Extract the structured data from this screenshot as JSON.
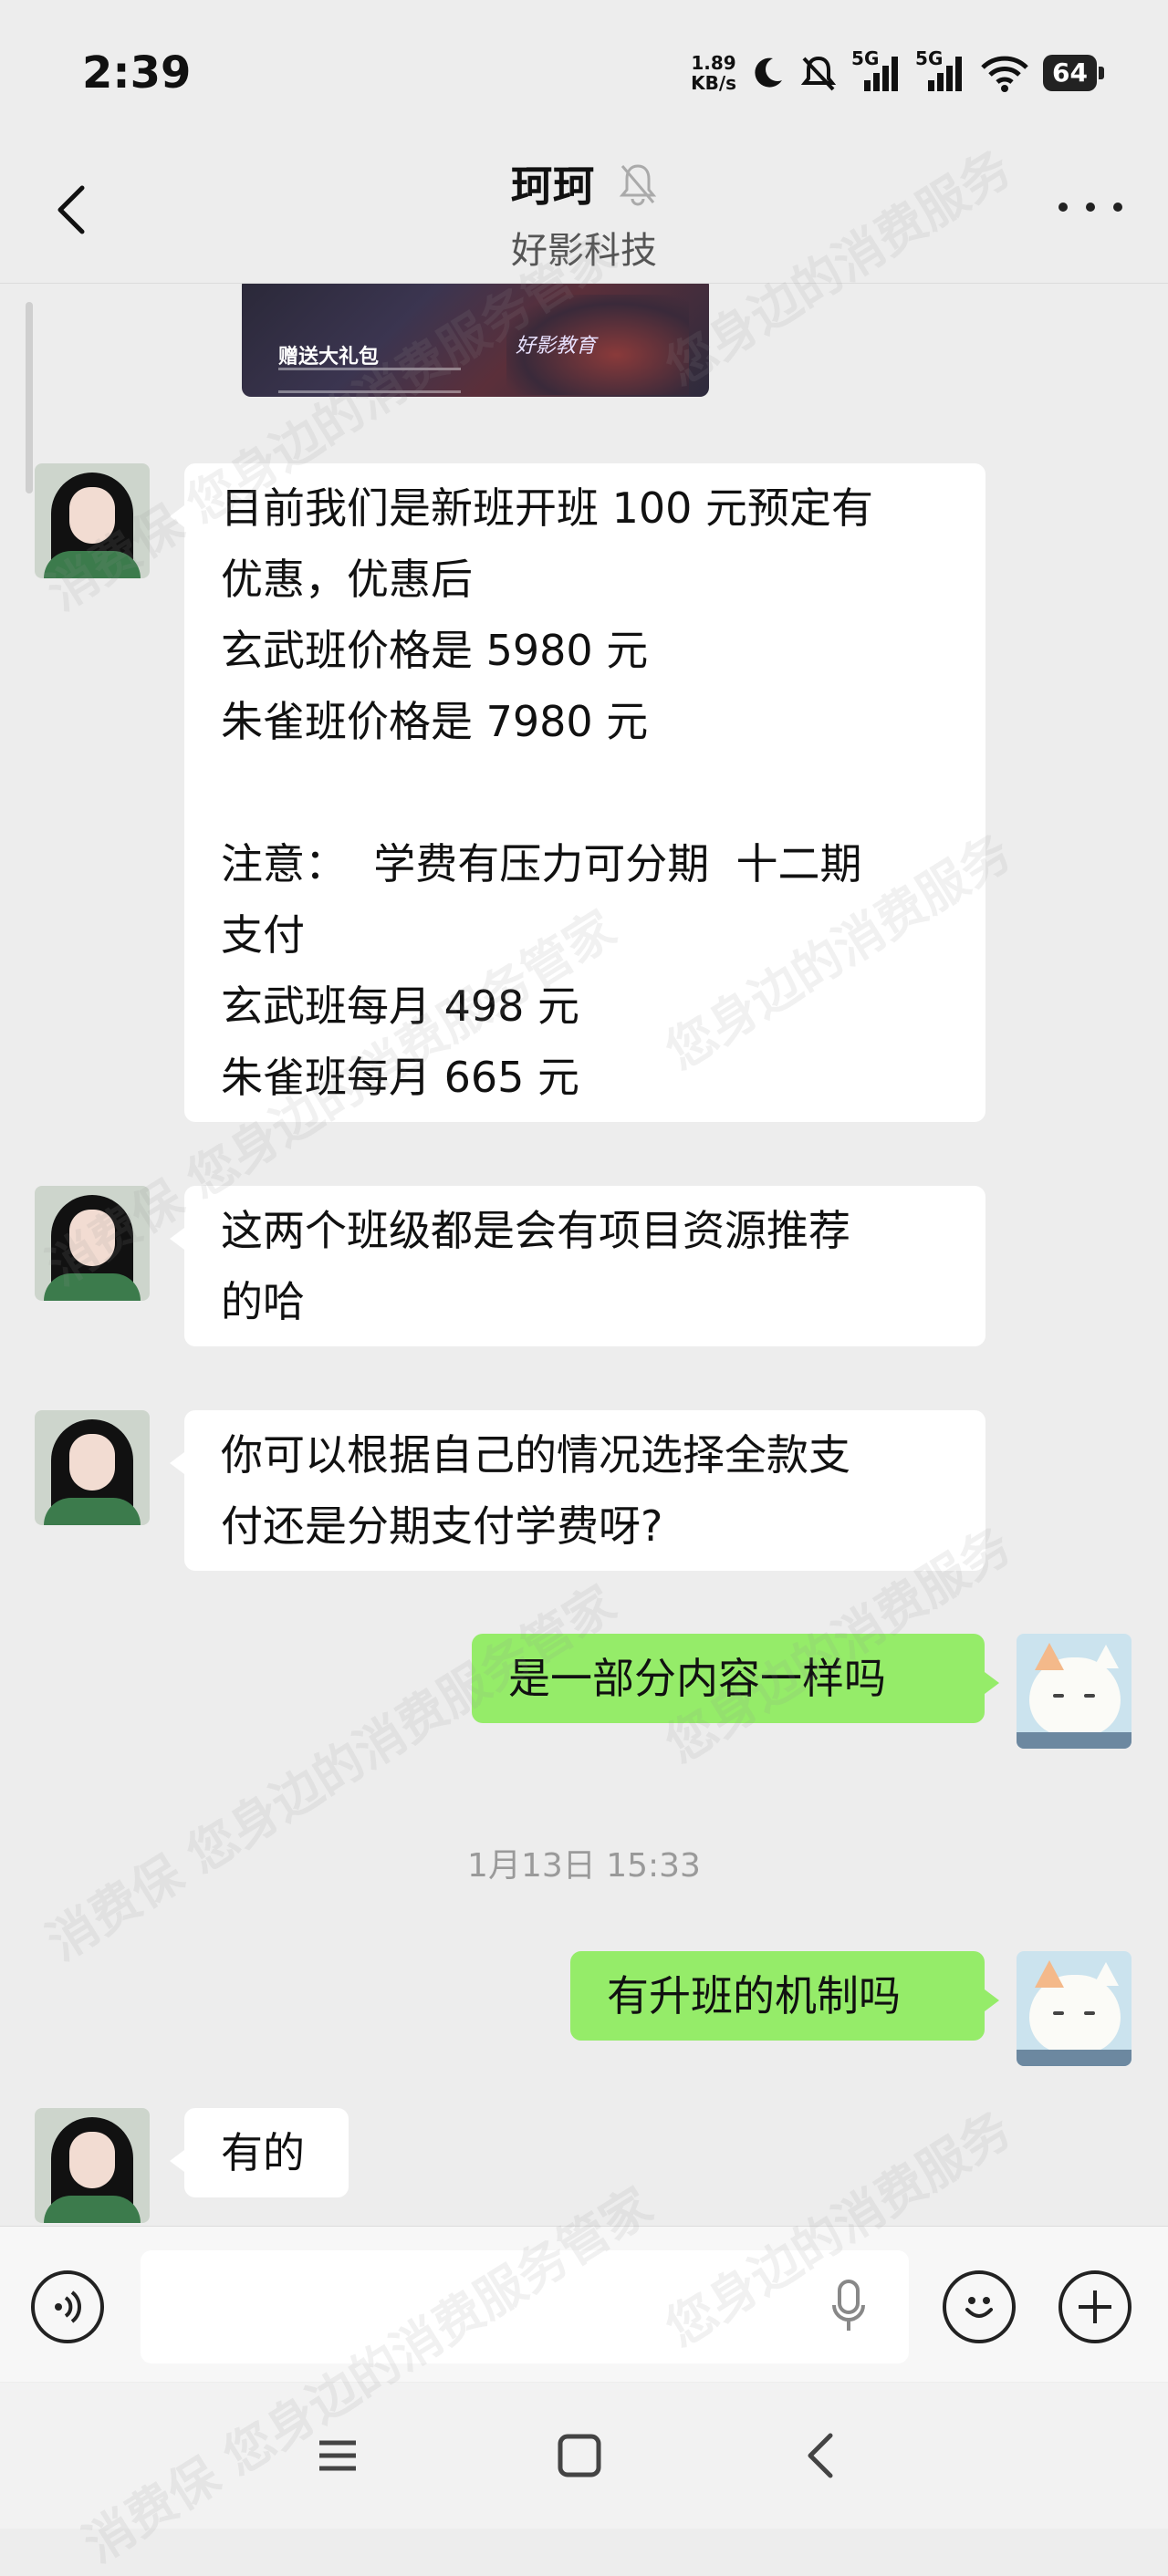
{
  "status_bar": {
    "time": "2:39",
    "net_speed_value": "1.89",
    "net_speed_unit": "KB/s",
    "signal1_label": "5G",
    "signal2_label": "5G",
    "battery": "64"
  },
  "header": {
    "title": "珂珂",
    "subtitle": "好影科技"
  },
  "banner": {
    "gift_text": "赠送大礼包",
    "logo_text": "好影教育"
  },
  "messages": [
    {
      "side": "in",
      "lines": [
        "目前我们是新班开班 100 元预定有",
        "优惠，优惠后",
        "玄武班价格是 5980 元",
        "朱雀班价格是 7980 元",
        "",
        "注意：  学费有压力可分期  十二期",
        "支付",
        "玄武班每月 498 元",
        "朱雀班每月 665 元"
      ]
    },
    {
      "side": "in",
      "lines": [
        "这两个班级都是会有项目资源推荐",
        "的哈"
      ]
    },
    {
      "side": "in",
      "lines": [
        "你可以根据自己的情况选择全款支",
        "付还是分期支付学费呀?"
      ]
    },
    {
      "side": "out",
      "lines": [
        "是一部分内容一样吗"
      ]
    },
    {
      "side": "out",
      "lines": [
        "有升班的机制吗"
      ]
    },
    {
      "side": "in",
      "lines": [
        "有的"
      ]
    }
  ],
  "timestamp": "1月13日 15:33",
  "input": {
    "value": ""
  },
  "watermark": {
    "a": "消费保  您身边的消费服务管家",
    "b": "您身边的消费服务"
  },
  "colors": {
    "background": "#ededed",
    "bubble_out": "#95ec69",
    "bubble_in": "#ffffff",
    "timestamp": "#9a9a9a"
  },
  "icons": [
    "back-icon",
    "mute-bell-icon",
    "more-icon",
    "voice-icon",
    "mic-icon",
    "emoji-icon",
    "plus-icon",
    "menu-icon",
    "home-icon",
    "nav-back-icon"
  ]
}
